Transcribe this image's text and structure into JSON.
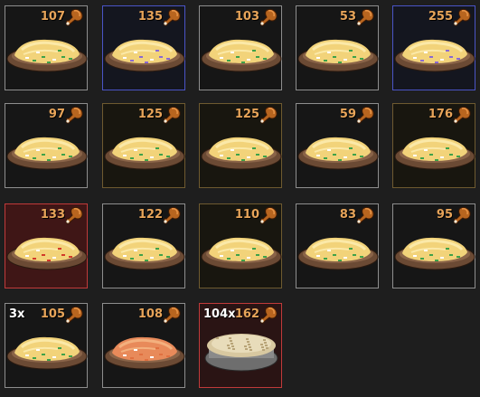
{
  "colors": {
    "value_text": "#e7a459",
    "count_text": "#ffffff",
    "border_default": "#8e8e8e",
    "border_blue": "#4a54c6",
    "border_gold": "#6e5a30",
    "border_red": "#c03a3a",
    "bg_red": "#3f1616"
  },
  "icons": {
    "value_icon": "drumstick-icon"
  },
  "inventory": {
    "items": [
      {
        "value": "107",
        "count": "",
        "frame": "default",
        "food": "omelette-platter",
        "garnish": "green"
      },
      {
        "value": "135",
        "count": "",
        "frame": "blue",
        "food": "omelette-platter",
        "garnish": "purple"
      },
      {
        "value": "103",
        "count": "",
        "frame": "default",
        "food": "omelette-platter",
        "garnish": "green"
      },
      {
        "value": "53",
        "count": "",
        "frame": "default",
        "food": "omelette-platter",
        "garnish": "green"
      },
      {
        "value": "255",
        "count": "",
        "frame": "blue",
        "food": "omelette-platter",
        "garnish": "purple"
      },
      {
        "value": "97",
        "count": "",
        "frame": "default",
        "food": "omelette-platter",
        "garnish": "green"
      },
      {
        "value": "125",
        "count": "",
        "frame": "gold",
        "food": "omelette-platter",
        "garnish": "green"
      },
      {
        "value": "125",
        "count": "",
        "frame": "gold",
        "food": "omelette-platter",
        "garnish": "green"
      },
      {
        "value": "59",
        "count": "",
        "frame": "default",
        "food": "omelette-platter",
        "garnish": "green"
      },
      {
        "value": "176",
        "count": "",
        "frame": "gold",
        "food": "omelette-platter",
        "garnish": "green"
      },
      {
        "value": "133",
        "count": "",
        "frame": "red",
        "food": "omelette-platter",
        "garnish": "red"
      },
      {
        "value": "122",
        "count": "",
        "frame": "default",
        "food": "omelette-platter",
        "garnish": "green"
      },
      {
        "value": "110",
        "count": "",
        "frame": "gold",
        "food": "omelette-platter",
        "garnish": "green"
      },
      {
        "value": "83",
        "count": "",
        "frame": "default",
        "food": "omelette-platter",
        "garnish": "green"
      },
      {
        "value": "95",
        "count": "",
        "frame": "default",
        "food": "omelette-platter",
        "garnish": "green"
      },
      {
        "value": "105",
        "count": "3x",
        "frame": "default",
        "food": "omelette-platter",
        "garnish": "green"
      },
      {
        "value": "108",
        "count": "",
        "frame": "default",
        "food": "omelette-platter",
        "garnish": "orange"
      },
      {
        "value": "162",
        "count": "104x",
        "frame": "red2",
        "food": "pie",
        "garnish": "none"
      }
    ]
  }
}
